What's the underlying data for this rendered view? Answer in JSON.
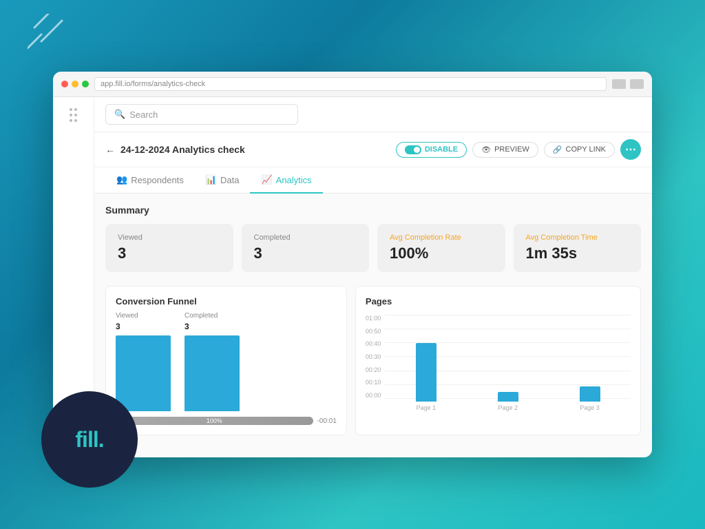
{
  "background": {
    "color_start": "#1a9bbc",
    "color_end": "#2ec4c4"
  },
  "logo": {
    "text": "fill."
  },
  "browser": {
    "url": "app.fill.io/forms/analytics-check"
  },
  "search": {
    "placeholder": "Search"
  },
  "page": {
    "title": "24-12-2024 Analytics check",
    "back_label": "←"
  },
  "header_buttons": {
    "disable": "DISABLE",
    "preview": "PREVIEW",
    "copy_link": "COPY LINK",
    "more": "⋯"
  },
  "tabs": [
    {
      "label": "Respondents",
      "icon": "users-icon",
      "active": false
    },
    {
      "label": "Data",
      "icon": "table-icon",
      "active": false
    },
    {
      "label": "Analytics",
      "icon": "chart-icon",
      "active": true
    }
  ],
  "summary": {
    "title": "Summary",
    "cards": [
      {
        "label": "Viewed",
        "value": "3"
      },
      {
        "label": "Completed",
        "value": "3"
      },
      {
        "label": "Avg Completion Rate",
        "value": "100%",
        "label_color": "orange"
      },
      {
        "label": "Avg Completion Time",
        "value": "1m 35s",
        "label_color": "orange"
      }
    ]
  },
  "funnel": {
    "title": "Conversion Funnel",
    "viewed_label": "Viewed",
    "viewed_count": "3",
    "completed_label": "Completed",
    "completed_count": "3",
    "progress_value": "100%",
    "time_label": "-00:01",
    "bar_viewed_height": 120,
    "bar_completed_height": 120
  },
  "pages_chart": {
    "title": "Pages",
    "y_axis_labels": [
      "01:00",
      "00:50",
      "00:40",
      "00:30",
      "00:20",
      "00:10",
      "00:00"
    ],
    "bars": [
      {
        "label": "Page 1",
        "height": 85,
        "value": "00:43"
      },
      {
        "label": "Page 2",
        "height": 14,
        "value": "00:07"
      },
      {
        "label": "Page 3",
        "height": 22,
        "value": "00:11"
      }
    ]
  }
}
